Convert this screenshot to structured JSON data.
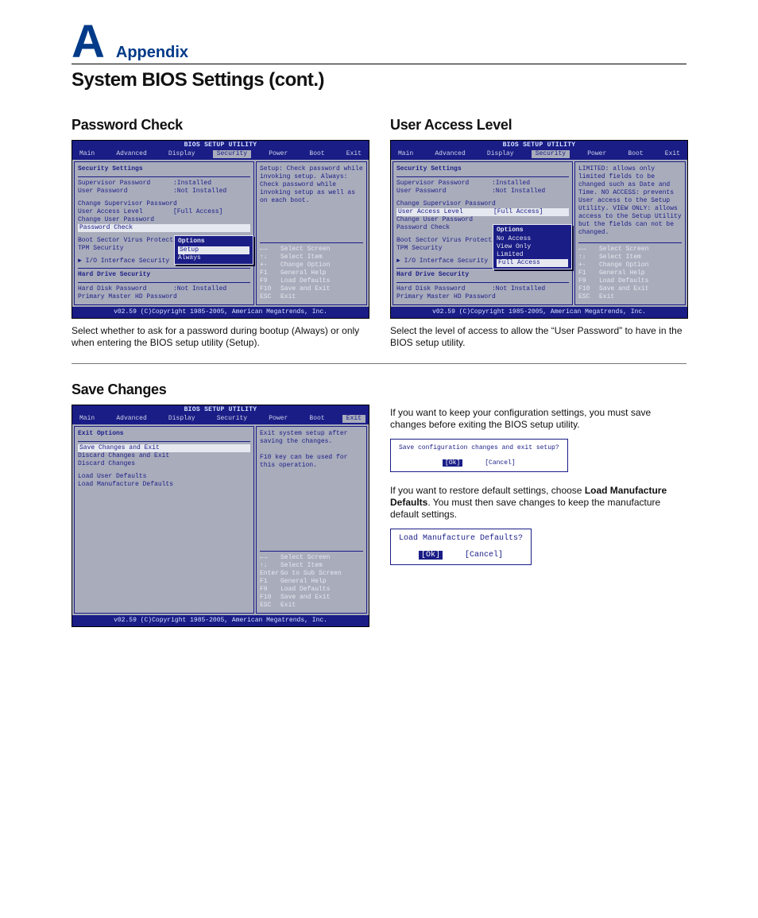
{
  "header": {
    "letter": "A",
    "word": "Appendix"
  },
  "page_title": "System BIOS Settings (cont.)",
  "sections": {
    "password_check": {
      "heading": "Password Check",
      "caption": "Select whether to ask for a password during bootup (Always) or only when entering the BIOS setup utility (Setup)."
    },
    "user_access": {
      "heading": "User Access Level",
      "caption": "Select the level of access to allow the “User Password” to have in the BIOS setup utility."
    },
    "save_changes": {
      "heading": "Save Changes",
      "para1": "If you want to keep your configuration settings, you must save changes before exiting the BIOS setup utility.",
      "para2_pre": "If you want to restore default settings, choose ",
      "para2_bold": "Load Manufacture Defaults",
      "para2_post": ". You must then save changes to keep the manufacture default settings."
    }
  },
  "bios_common": {
    "title": "BIOS SETUP UTILITY",
    "menu": [
      "Main",
      "Advanced",
      "Display",
      "Security",
      "Power",
      "Boot",
      "Exit"
    ],
    "footer": "v02.59 (C)Copyright 1985-2005, American Megatrends, Inc.",
    "keys_security": [
      [
        "←→",
        "Select Screen"
      ],
      [
        "↑↓",
        "Select Item"
      ],
      [
        "+-",
        "Change Option"
      ],
      [
        "F1",
        "General Help"
      ],
      [
        "F9",
        "Load Defaults"
      ],
      [
        "F10",
        "Save and Exit"
      ],
      [
        "ESC",
        "Exit"
      ]
    ],
    "keys_exit": [
      [
        "←→",
        "Select Screen"
      ],
      [
        "↑↓",
        "Select Item"
      ],
      [
        "Enter",
        "Go to Sub Screen"
      ],
      [
        "F1",
        "General Help"
      ],
      [
        "F9",
        "Load Defaults"
      ],
      [
        "F10",
        "Save and Exit"
      ],
      [
        "ESC",
        "Exit"
      ]
    ]
  },
  "bios_pw": {
    "active_menu": "Security",
    "section": "Security Settings",
    "rows": {
      "sup": {
        "k": "Supervisor Password",
        "v": ":Installed"
      },
      "usr": {
        "k": "User Password",
        "v": ":Not Installed"
      }
    },
    "items": {
      "csp": "Change Supervisor Password",
      "ual": "User Access Level",
      "ual_val": "[Full Access]",
      "cup": "Change User Password",
      "pwc": "Password Check",
      "bsv": "Boot Sector Virus Protectio",
      "tpm": "TPM Security",
      "iio": "► I/O Interface Security",
      "hds": "Hard Drive Security",
      "hdp": {
        "k": "Hard Disk Password",
        "v": ":Not Installed"
      },
      "pmp": "Primary Master HD Password"
    },
    "popup": {
      "title": "Options",
      "opts": [
        "Setup",
        "Always"
      ],
      "sel": 0
    },
    "help": "Setup: Check password while invoking setup. Always: Check password while invoking setup as well as on each boot."
  },
  "bios_ua": {
    "active_menu": "Security",
    "section": "Security Settings",
    "rows": {
      "sup": {
        "k": "Supervisor Password",
        "v": ":Installed"
      },
      "usr": {
        "k": "User Password",
        "v": ":Not Installed"
      }
    },
    "items": {
      "csp": "Change Supervisor Password",
      "ual": "User Access Level",
      "ual_val": "[Full Access]",
      "cup": "Change User Password",
      "pwc": "Password Check",
      "bsv": "Boot Sector Virus Protectio",
      "tpm": "TPM Security",
      "iio": "► I/O Interface Security",
      "hds": "Hard Drive Security",
      "hdp": {
        "k": "Hard Disk Password",
        "v": ":Not Installed"
      },
      "pmp": "Primary Master HD Password"
    },
    "popup": {
      "title": "Options",
      "opts": [
        "No Access",
        "View Only",
        "Limited",
        "Full Access"
      ],
      "sel": 3
    },
    "help": "LIMITED: allows only limited fields to be changed such as Date and Time. NO ACCESS: prevents User access to the Setup Utility. VIEW ONLY: allows access to the Setup Utility but the fields can not be changed."
  },
  "bios_sc": {
    "active_menu": "Exit",
    "section": "Exit Options",
    "items": {
      "sce": "Save Changes and Exit",
      "dce": "Discard Changes and Exit",
      "dc": "Discard Changes",
      "lud": "Load User Defaults",
      "lmd": "Load Manufacture Defaults"
    },
    "help": "Exit system setup after saving the changes.\n\nF10 key can be used for this operation."
  },
  "dialogs": {
    "save": {
      "msg": "Save configuration changes and exit setup?",
      "ok": "[Ok]",
      "cancel": "[Cancel]"
    },
    "load": {
      "msg": "Load Manufacture Defaults?",
      "ok": "[Ok]",
      "cancel": "[Cancel]"
    }
  }
}
